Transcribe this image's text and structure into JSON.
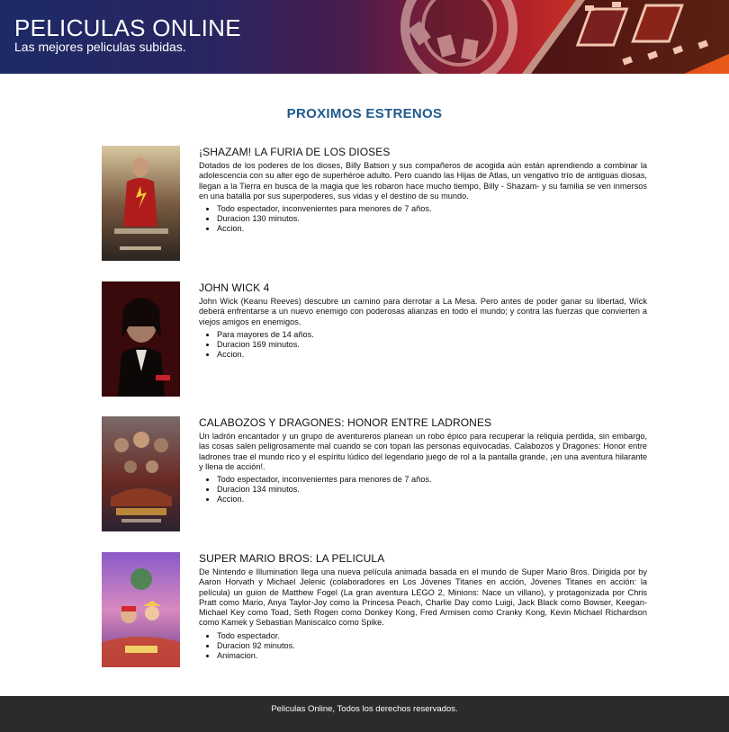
{
  "header": {
    "title": "PELICULAS ONLINE",
    "subtitle": "Las mejores peliculas subidas."
  },
  "section": {
    "title": "PROXIMOS ESTRENOS"
  },
  "movies": [
    {
      "title": "¡SHAZAM! LA FURIA DE LOS DIOSES",
      "description": "Dotados de los poderes de los dioses, Billy Batson y sus compañeros de acogida aún están aprendiendo a combinar la adolescencia con su alter ego de superhéroe adulto. Pero cuando las Hijas de Atlas, un vengativo trío de antiguas diosas, llegan a la Tierra en busca de la magia que les robaron hace mucho tiempo, Billy - Shazam- y su familia se ven inmersos en una batalla por sus superpoderes, sus vidas y el destino de su mundo.",
      "details": [
        "Todo espectador, inconvenientes para menores de 7 años.",
        "Duracion 130 minutos.",
        "Accion."
      ],
      "poster_colors": [
        "#c9b48a",
        "#8a2a22",
        "#3a2b24"
      ]
    },
    {
      "title": "JOHN WICK 4",
      "description": "John Wick (Keanu Reeves) descubre un camino para derrotar a La Mesa. Pero antes de poder ganar su libertad, Wick deberá enfrentarse a un nuevo enemigo con poderosas alianzas en todo el mundo; y contra las fuerzas que convierten a viejos amigos en enemigos.",
      "details": [
        "Para mayores de 14 años.",
        "Duracion 169 minutos.",
        "Accion."
      ],
      "poster_colors": [
        "#7a0e12",
        "#120a0a",
        "#d9cfc4"
      ]
    },
    {
      "title": "CALABOZOS Y DRAGONES: HONOR ENTRE LADRONES",
      "description": "Un ladrón encantador y un grupo de aventureros planean un robo épico para recuperar la reliquia perdida, sin embargo, las cosas salen peligrosamente mal cuando se con topan las personas equivocadas. Calabozos y Dragones: Honor entre ladrones trae el mundo rico y el espíritu lúdico del legendario juego de rol a la pantalla grande, ¡en una aventura hilarante y llena de acción!.",
      "details": [
        "Todo espectador, inconvenientes para menores de 7 años.",
        "Duracion 134 minutos.",
        "Accion."
      ],
      "poster_colors": [
        "#6e5a52",
        "#8a2f24",
        "#2f2a36"
      ]
    },
    {
      "title": "SUPER MARIO BROS: LA PELICULA",
      "description": "De Nintendo e Illumination llega una nueva película animada basada en el mundo de Super Mario Bros. Dirigida por by Aaron Horvath y Michael Jelenic (colaboradores en Los Jóvenes Titanes en acción, Jóvenes Titanes en acción: la película) un guion de Matthew Fogel (La gran aventura LEGO 2, Minions: Nace un villano), y protagonizada por Chris Pratt como Mario, Anya Taylor-Joy como la Princesa Peach, Charlie Day como Luigi, Jack Black como Bowser, Keegan-Michael Key como Toad, Seth Rogen como Donkey Kong, Fred Armisen como Cranky Kong, Kevin Michael Richardson como Kamek y Sebastian Maniscalco como Spike.",
      "details": [
        "Todo espectador.",
        "Duracion 92 minutos.",
        "Animacion."
      ],
      "poster_colors": [
        "#7a4bb8",
        "#e8a0c8",
        "#c8442a"
      ]
    }
  ],
  "footer": {
    "text": "Peliculas Online, Todos los derechos reservados."
  }
}
